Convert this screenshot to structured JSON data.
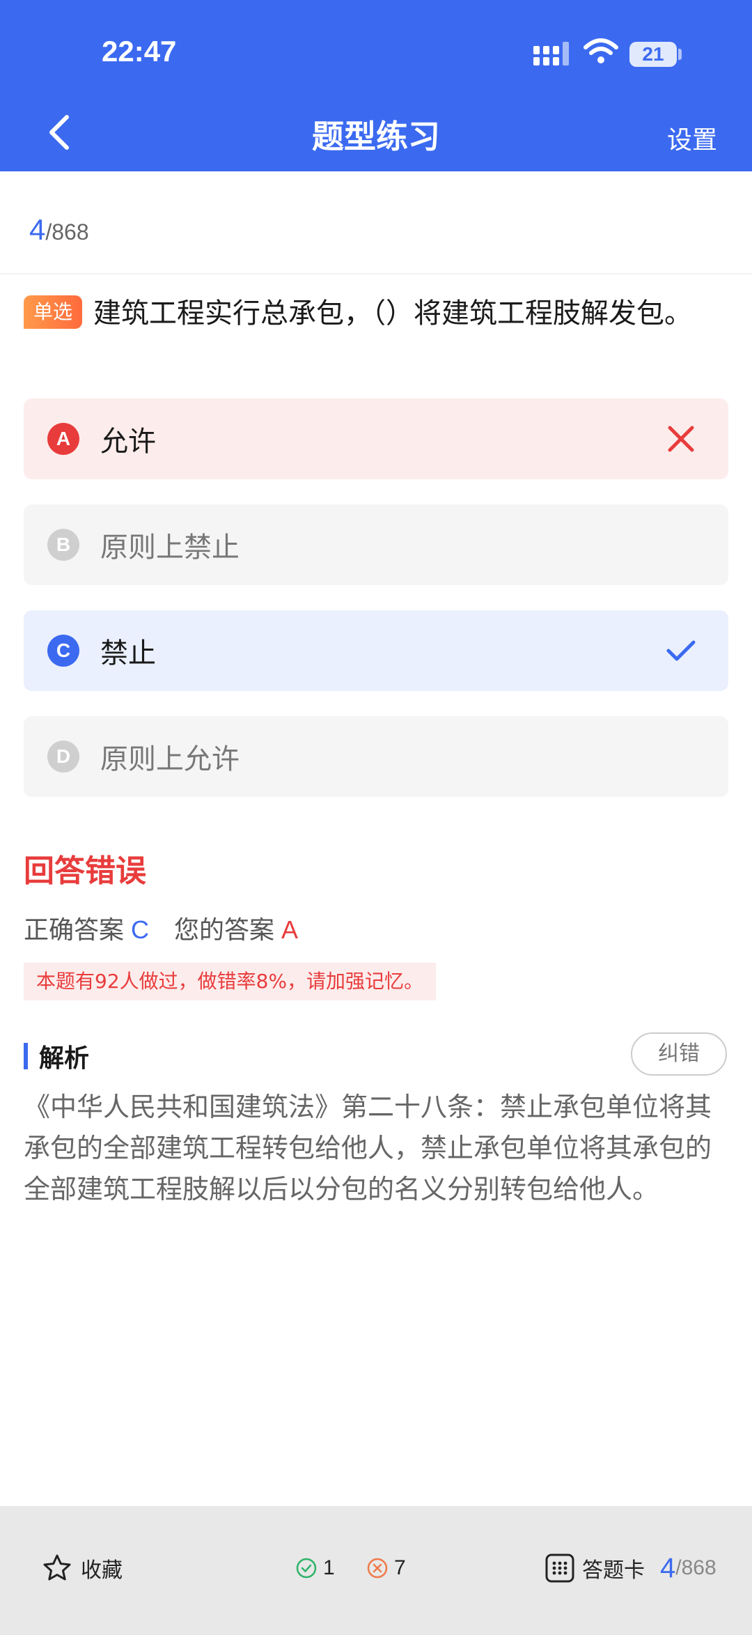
{
  "status_bar": {
    "time": "22:47",
    "battery": "21"
  },
  "header": {
    "title": "题型练习",
    "settings_label": "设置"
  },
  "progress": {
    "current": "4",
    "total": "/868"
  },
  "question": {
    "type_badge": "单选",
    "text": "建筑工程实行总承包，（）将建筑工程肢解发包。"
  },
  "options": [
    {
      "letter": "A",
      "text": "允许",
      "state": "wrong"
    },
    {
      "letter": "B",
      "text": "原则上禁止",
      "state": "normal"
    },
    {
      "letter": "C",
      "text": "禁止",
      "state": "correct"
    },
    {
      "letter": "D",
      "text": "原则上允许",
      "state": "normal"
    }
  ],
  "result": {
    "title": "回答错误",
    "correct_label": "正确答案",
    "correct_value": "C",
    "yours_label": "您的答案",
    "yours_value": "A",
    "stat_note": "本题有92人做过，做错率8%，请加强记忆。"
  },
  "analysis": {
    "title": "解析",
    "report_label": "纠错",
    "body": "《中华人民共和国建筑法》第二十八条：禁止承包单位将其承包的全部建筑工程转包给他人，禁止承包单位将其承包的全部建筑工程肢解以后以分包的名义分别转包给他人。"
  },
  "bottom_bar": {
    "favorite_label": "收藏",
    "right_count": "1",
    "wrong_count": "7",
    "answer_card_label": "答题卡",
    "progress_current": "4",
    "progress_total": "/868"
  },
  "colors": {
    "primary": "#3b6af0",
    "error": "#e83c3c",
    "success": "#2fb36a"
  }
}
